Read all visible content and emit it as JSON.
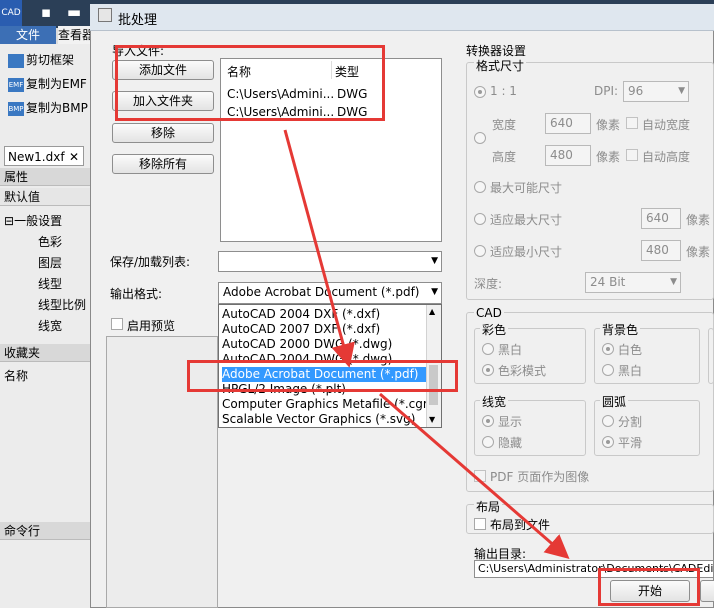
{
  "app": {
    "logo": "CAD",
    "menu_file": "文件",
    "menu_view": "查看器",
    "tools": [
      "剪切框架",
      "复制为EMF",
      "复制为BMP"
    ],
    "doc_tab": "New1.dxf",
    "properties": {
      "header": "属性",
      "default": "默认值",
      "group": "一般设置",
      "rows": [
        "色彩",
        "图层",
        "线型",
        "线型比例",
        "线宽"
      ]
    },
    "favorites": {
      "header": "收藏夹",
      "name_col": "名称"
    },
    "command_line": "命令行"
  },
  "dialog": {
    "title": "批处理",
    "import_label": "导入文件:",
    "buttons": {
      "add_file": "添加文件",
      "add_folder": "加入文件夹",
      "remove": "移除",
      "remove_all": "移除所有",
      "start": "开始"
    },
    "file_list": {
      "headers": [
        "名称",
        "类型"
      ],
      "rows": [
        {
          "name": "C:\\Users\\Admini...",
          "type": "DWG"
        },
        {
          "name": "C:\\Users\\Admini...",
          "type": "DWG"
        }
      ]
    },
    "save_load_label": "保存/加载列表:",
    "save_load_value": "",
    "output_format_label": "输出格式:",
    "output_format_value": "Adobe Acrobat Document (*.pdf)",
    "format_options": [
      "AutoCAD 2004 DXF (*.dxf)",
      "AutoCAD 2007 DXF (*.dxf)",
      "AutoCAD 2000 DWG (*.dwg)",
      "AutoCAD 2004 DWG (*.dwg)",
      "Adobe Acrobat Document (*.pdf)",
      "HPGL/2 Image (*.plt)",
      "Computer Graphics Metafile (*.cgm)",
      "Scalable Vector Graphics (*.svg)"
    ],
    "selected_option_index": 4,
    "enable_preview": "启用预览",
    "converter": {
      "title": "转换器设置",
      "format_size": "格式尺寸",
      "ratio": "1 : 1",
      "dpi_label": "DPI:",
      "dpi_value": "96",
      "width_label": "宽度",
      "width_value": "640",
      "height_label": "高度",
      "height_value": "480",
      "unit": "像素",
      "auto_width": "自动宽度",
      "auto_height": "自动高度",
      "max_possible": "最大可能尺寸",
      "fit_max": "适应最大尺寸",
      "fit_max_value": "640",
      "fit_min": "适应最小尺寸",
      "fit_min_value": "480",
      "depth_label": "深度:",
      "depth_value": "24 Bit"
    },
    "cad": {
      "title": "CAD",
      "color_title": "彩色",
      "bw": "黑白",
      "color_mode": "色彩模式",
      "bg_title": "背景色",
      "white": "白色",
      "black": "黑白",
      "lw_title": "线宽",
      "show": "显示",
      "hide": "隐藏",
      "arc_title": "圆弧",
      "split": "分割",
      "smooth": "平滑",
      "pdf_as_image": "PDF 页面作为图像"
    },
    "layout": {
      "title": "布局",
      "layout_to_file": "布局到文件"
    },
    "output_dir_label": "输出目录:",
    "output_dir_value": "C:\\Users\\Administrator\\Documents\\CADEdit"
  },
  "colors": {
    "annotation_red": "#e53935",
    "selection_blue": "#3399ff"
  }
}
